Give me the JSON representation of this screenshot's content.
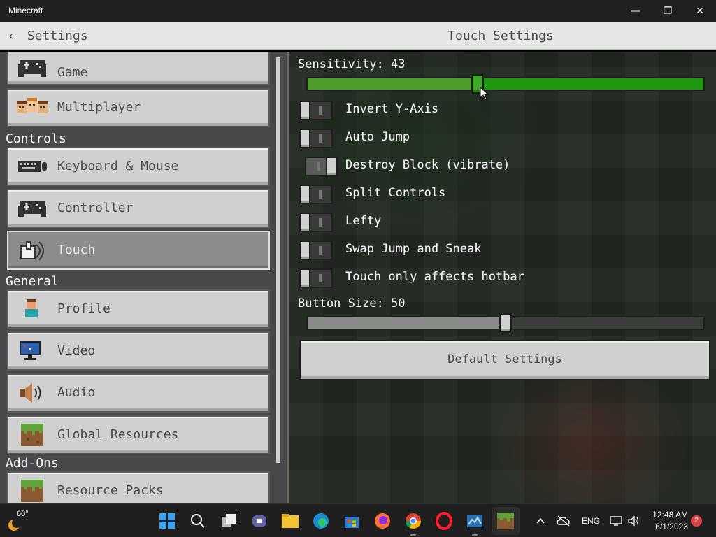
{
  "window": {
    "title": "Minecraft"
  },
  "header": {
    "back_label": "Settings",
    "page_title": "Touch Settings"
  },
  "sidebar": {
    "partial_top_item": "Game",
    "items_top": [
      {
        "label": "Multiplayer",
        "icon": "multiplayer-icon"
      }
    ],
    "controls_header": "Controls",
    "controls_items": [
      {
        "label": "Keyboard & Mouse",
        "icon": "keyboard-icon"
      },
      {
        "label": "Controller",
        "icon": "controller-icon"
      },
      {
        "label": "Touch",
        "icon": "touch-icon",
        "active": true
      }
    ],
    "general_header": "General",
    "general_items": [
      {
        "label": "Profile",
        "icon": "profile-icon"
      },
      {
        "label": "Video",
        "icon": "monitor-icon"
      },
      {
        "label": "Audio",
        "icon": "speaker-icon"
      },
      {
        "label": "Global Resources",
        "icon": "grass-block-icon"
      }
    ],
    "addons_header": "Add-Ons",
    "addons_items": [
      {
        "label": "Resource Packs",
        "icon": "grass-block-icon"
      }
    ]
  },
  "settings": {
    "sensitivity": {
      "label": "Sensitivity: 43",
      "value": 43,
      "min": 0,
      "max": 100
    },
    "toggles": [
      {
        "label": "Invert Y-Axis",
        "on": false
      },
      {
        "label": "Auto Jump",
        "on": false
      },
      {
        "label": "Destroy Block (vibrate)",
        "on": true
      },
      {
        "label": "Split Controls",
        "on": false
      },
      {
        "label": "Lefty",
        "on": false
      },
      {
        "label": "Swap Jump and Sneak",
        "on": false
      },
      {
        "label": "Touch only affects hotbar",
        "on": false
      }
    ],
    "button_size": {
      "label": "Button Size: 50",
      "value": 50,
      "min": 0,
      "max": 100
    },
    "default_button": "Default Settings"
  },
  "taskbar": {
    "weather_temp": "60°",
    "lang": "ENG",
    "time": "12:48 AM",
    "date": "6/1/2023",
    "notification_count": "2",
    "apps": [
      "start-icon",
      "search-icon",
      "task-view-icon",
      "teams-chat-icon",
      "file-explorer-icon",
      "edge-icon",
      "store-icon",
      "firefox-icon",
      "chrome-icon",
      "opera-icon",
      "photos-icon",
      "minecraft-icon"
    ]
  },
  "colors": {
    "accent_green": "#4f9e2d",
    "accent_green_bright": "#1f9a10",
    "button_gray": "#d0d0d0",
    "sidebar_bg": "#48494a"
  }
}
